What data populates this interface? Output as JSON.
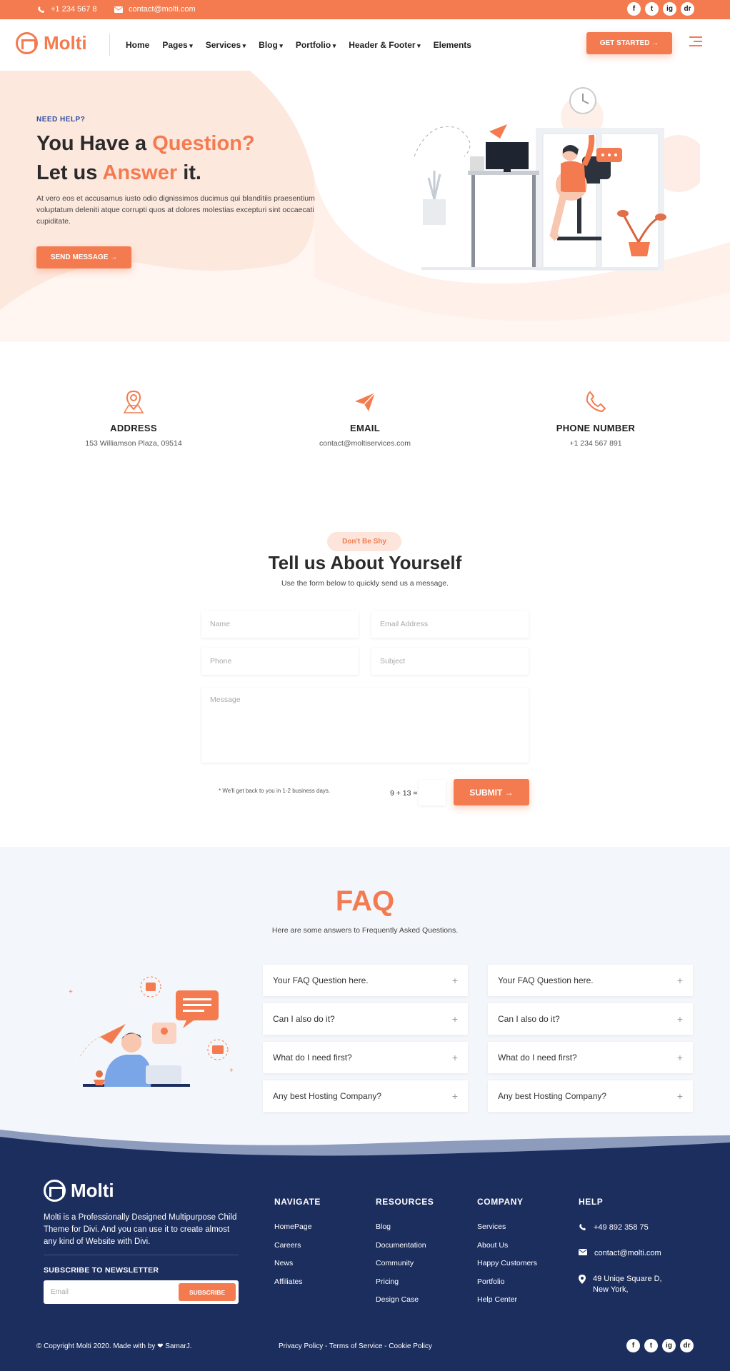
{
  "colors": {
    "accent": "#f47b4f",
    "navy": "#1c2e5e",
    "hero_bg": "#fde8de",
    "faq_bg": "#f3f6fa"
  },
  "topbar": {
    "phone": "+1 234 567 8",
    "email": "contact@molti.com",
    "social": [
      "f",
      "t",
      "ig",
      "dr"
    ]
  },
  "header": {
    "logo": "Molti",
    "nav": [
      {
        "label": "Home",
        "dropdown": false
      },
      {
        "label": "Pages",
        "dropdown": true
      },
      {
        "label": "Services",
        "dropdown": true
      },
      {
        "label": "Blog",
        "dropdown": true
      },
      {
        "label": "Portfolio",
        "dropdown": true
      },
      {
        "label": "Header & Footer",
        "dropdown": true
      },
      {
        "label": "Elements",
        "dropdown": false
      }
    ],
    "cta": "GET STARTED →"
  },
  "hero": {
    "eyebrow": "NEED HELP?",
    "title_1a": "You Have a ",
    "title_1b": "Question?",
    "title_2a": "Let us ",
    "title_2b": "Answer",
    "title_2c": " it.",
    "description": "At vero eos et accusamus iusto odio dignissimos ducimus qui blanditiis praesentium voluptatum deleniti atque corrupti quos at dolores molestias excepturi sint occaecati cupiditate.",
    "button": "SEND MESSAGE →"
  },
  "contact": [
    {
      "title": "ADDRESS",
      "value": "153 Williamson Plaza, 09514",
      "icon": "location-pin-icon"
    },
    {
      "title": "EMAIL",
      "value": "contact@moltiservices.com",
      "icon": "paper-plane-icon"
    },
    {
      "title": "PHONE NUMBER",
      "value": "+1 234 567 891",
      "icon": "phone-icon"
    }
  ],
  "form": {
    "pill": "Don't Be Shy",
    "title": "Tell us About Yourself",
    "subtitle": "Use the form below to quickly send us a message.",
    "name_ph": "Name",
    "email_ph": "Email Address",
    "phone_ph": "Phone",
    "subject_ph": "Subject",
    "message_ph": "Message",
    "note": "* We'll get back to you in 1-2 business days.",
    "captcha": "9 + 13 =",
    "submit": "SUBMIT →"
  },
  "faq": {
    "title": "FAQ",
    "subtitle": "Here are some answers to Frequently Asked Questions.",
    "left": [
      "Your FAQ Question here.",
      "Can I also do it?",
      "What do I need first?",
      "Any best Hosting Company?"
    ],
    "right": [
      "Your FAQ Question here.",
      "Can I also do it?",
      "What do I need first?",
      "Any best Hosting Company?"
    ]
  },
  "footer": {
    "logo": "Molti",
    "description": "Molti is a Professionally Designed  Multipurpose Child Theme for Divi. And you can use it to create almost any kind of Website with Divi.",
    "newsletter_title": "SUBSCRIBE TO NEWSLETTER",
    "email_ph": "Email",
    "subscribe": "SUBSCRIBE",
    "cols": [
      {
        "title": "NAVIGATE",
        "links": [
          "HomePage",
          "Careers",
          "News",
          "Affiliates"
        ]
      },
      {
        "title": "RESOURCES",
        "links": [
          "Blog",
          "Documentation",
          "Community",
          "Pricing",
          "Design Case"
        ]
      },
      {
        "title": "COMPANY",
        "links": [
          "Services",
          "About Us",
          "Happy Customers",
          "Portfolio",
          "Help Center"
        ]
      }
    ],
    "help": {
      "title": "HELP",
      "phone": "+49 892 358 75",
      "email": "contact@molti.com",
      "address": "49 Uniqe Square D, New York,"
    },
    "copyright": "© Copyright Molti 2020. Made with by ❤ SamarJ.",
    "legal": "Privacy Policy - Terms of Service - Cookie Policy",
    "social": [
      "f",
      "t",
      "ig",
      "dr"
    ]
  }
}
